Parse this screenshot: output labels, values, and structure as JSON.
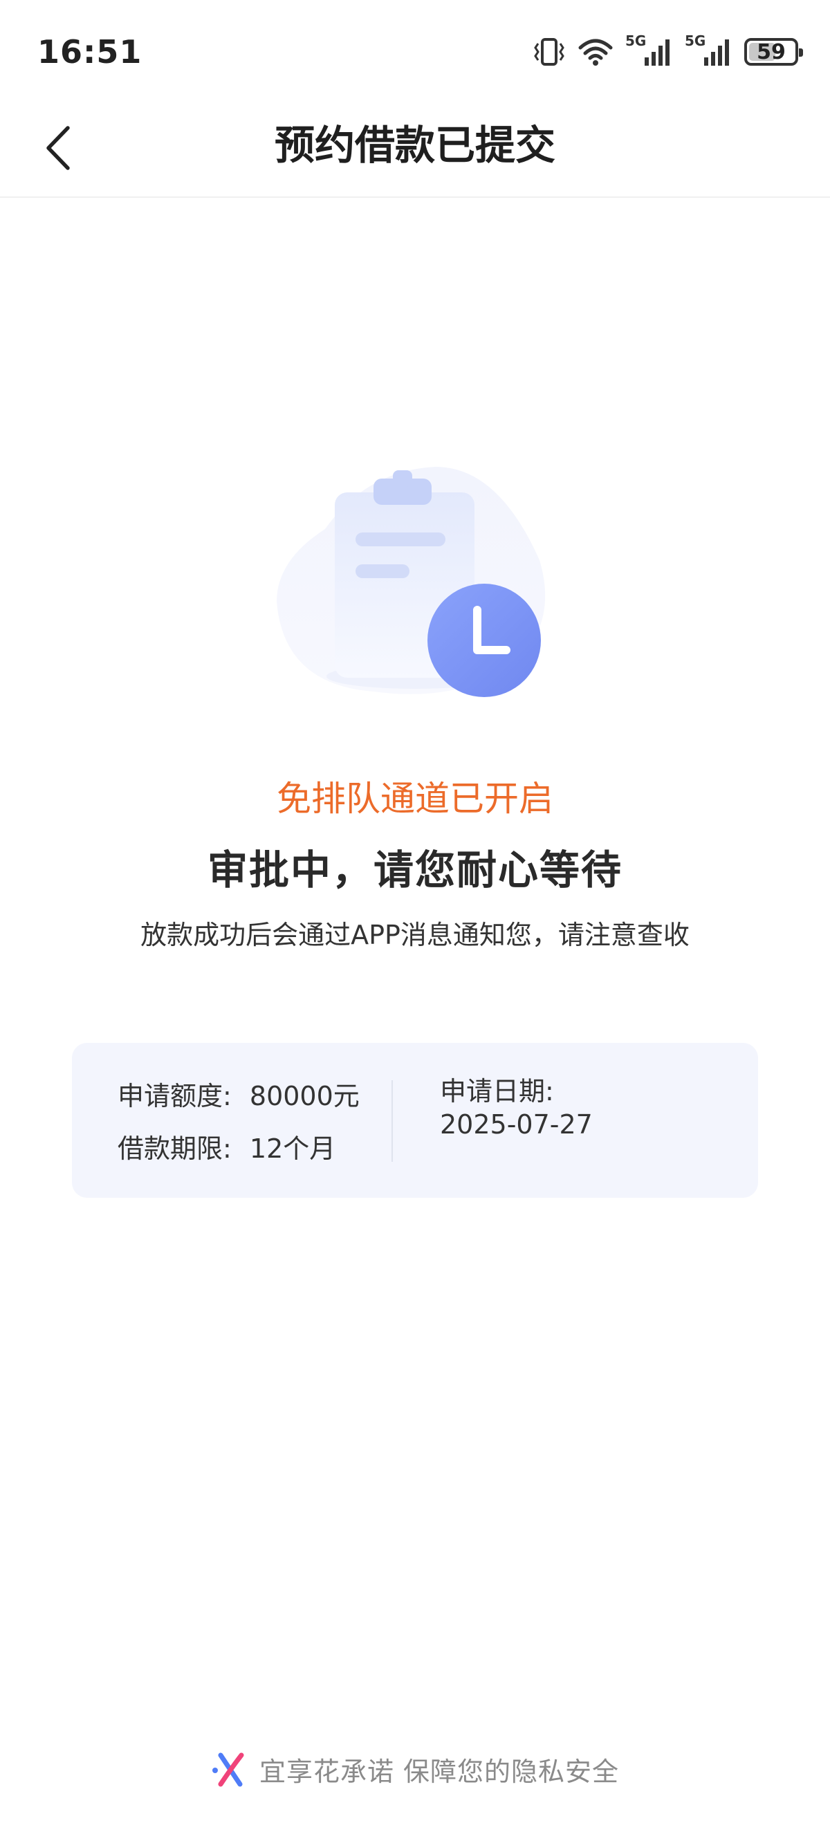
{
  "status_bar": {
    "time": "16:51",
    "network_1": "5G",
    "network_2": "5G",
    "battery": "59",
    "battery_level": 0.59,
    "icons": [
      "vibrate-icon",
      "wifi-icon",
      "signal-5g-icon",
      "signal-5g-icon",
      "battery-icon"
    ]
  },
  "nav": {
    "back_icon": "chevron-left-icon",
    "title": "预约借款已提交"
  },
  "illustration": {
    "icon": "clipboard-clock-icon"
  },
  "status": {
    "highlight": "免排队通道已开启",
    "headline": "审批中，请您耐心等待",
    "subtext": "放款成功后会通过APP消息通知您，请注意查收"
  },
  "info_card": {
    "amount_label": "申请额度:",
    "amount_value": "80000元",
    "term_label": "借款期限:",
    "term_value": "12个月",
    "date_label": "申请日期:",
    "date_value": "2025-07-27"
  },
  "footer": {
    "logo_icon": "yixianghua-logo-icon",
    "text": "宜享花承诺 保障您的隐私安全"
  },
  "colors": {
    "accent_orange": "#ec6b2a",
    "clock_blue": "#7d95f6",
    "card_bg": "#f3f5fd"
  }
}
